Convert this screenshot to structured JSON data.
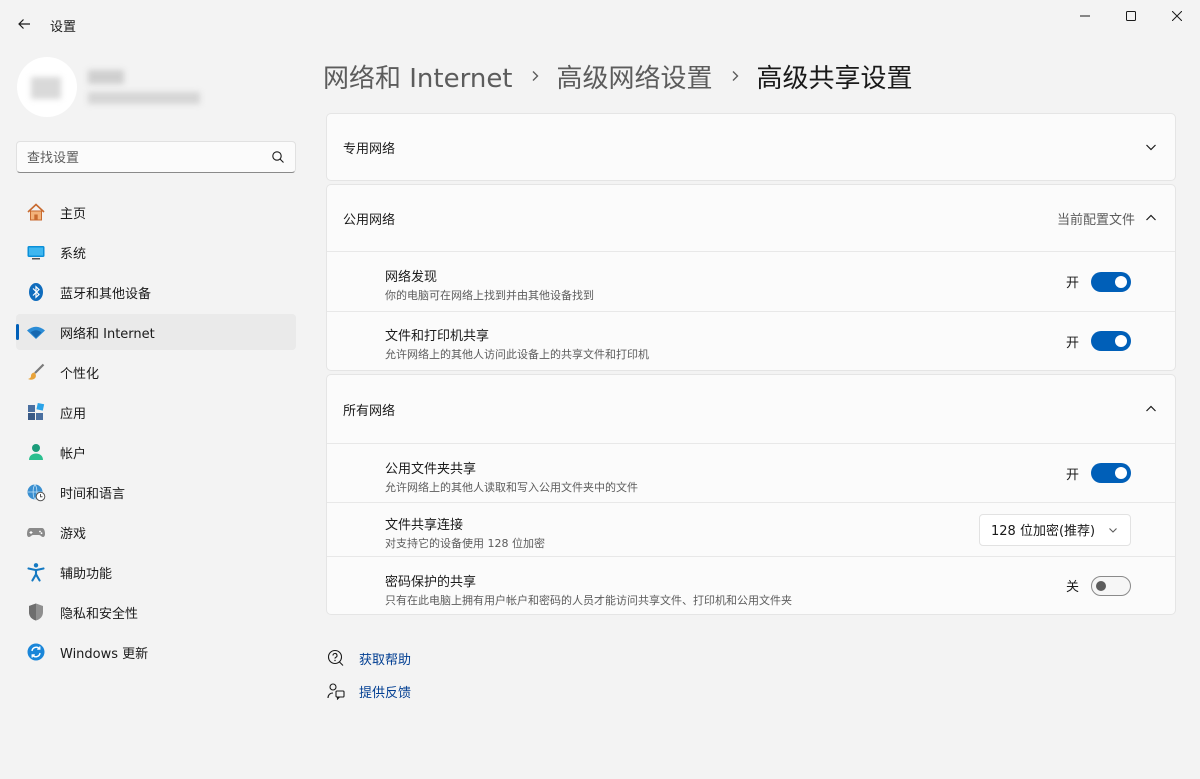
{
  "window": {
    "title": "设置",
    "controls": {
      "minimize": "minimize",
      "maximize": "maximize",
      "close": "close"
    }
  },
  "search": {
    "placeholder": "查找设置"
  },
  "nav": {
    "items": [
      {
        "label": "主页",
        "icon": "home-icon"
      },
      {
        "label": "系统",
        "icon": "system-icon"
      },
      {
        "label": "蓝牙和其他设备",
        "icon": "bluetooth-icon"
      },
      {
        "label": "网络和 Internet",
        "icon": "wifi-icon",
        "active": true
      },
      {
        "label": "个性化",
        "icon": "brush-icon"
      },
      {
        "label": "应用",
        "icon": "apps-icon"
      },
      {
        "label": "帐户",
        "icon": "account-icon"
      },
      {
        "label": "时间和语言",
        "icon": "globe-clock-icon"
      },
      {
        "label": "游戏",
        "icon": "gamepad-icon"
      },
      {
        "label": "辅助功能",
        "icon": "accessibility-icon"
      },
      {
        "label": "隐私和安全性",
        "icon": "shield-icon"
      },
      {
        "label": "Windows 更新",
        "icon": "update-icon"
      }
    ]
  },
  "breadcrumb": {
    "items": [
      "网络和 Internet",
      "高级网络设置",
      "高级共享设置"
    ]
  },
  "sections": {
    "private": {
      "title": "专用网络"
    },
    "public": {
      "title": "公用网络",
      "badge": "当前配置文件",
      "rows": [
        {
          "title": "网络发现",
          "desc": "你的电脑可在网络上找到并由其他设备找到",
          "state": "开",
          "on": true
        },
        {
          "title": "文件和打印机共享",
          "desc": "允许网络上的其他人访问此设备上的共享文件和打印机",
          "state": "开",
          "on": true
        }
      ]
    },
    "all": {
      "title": "所有网络",
      "rows": [
        {
          "title": "公用文件夹共享",
          "desc": "允许网络上的其他人读取和写入公用文件夹中的文件",
          "state": "开",
          "on": true
        },
        {
          "title": "文件共享连接",
          "desc": "对支持它的设备使用 128 位加密",
          "selected": "128 位加密(推荐)"
        },
        {
          "title": "密码保护的共享",
          "desc": "只有在此电脑上拥有用户帐户和密码的人员才能访问共享文件、打印机和公用文件夹",
          "state": "关",
          "on": false
        }
      ]
    }
  },
  "footer": {
    "help": "获取帮助",
    "feedback": "提供反馈"
  },
  "colors": {
    "accent": "#005fb8",
    "link": "#003e92"
  }
}
